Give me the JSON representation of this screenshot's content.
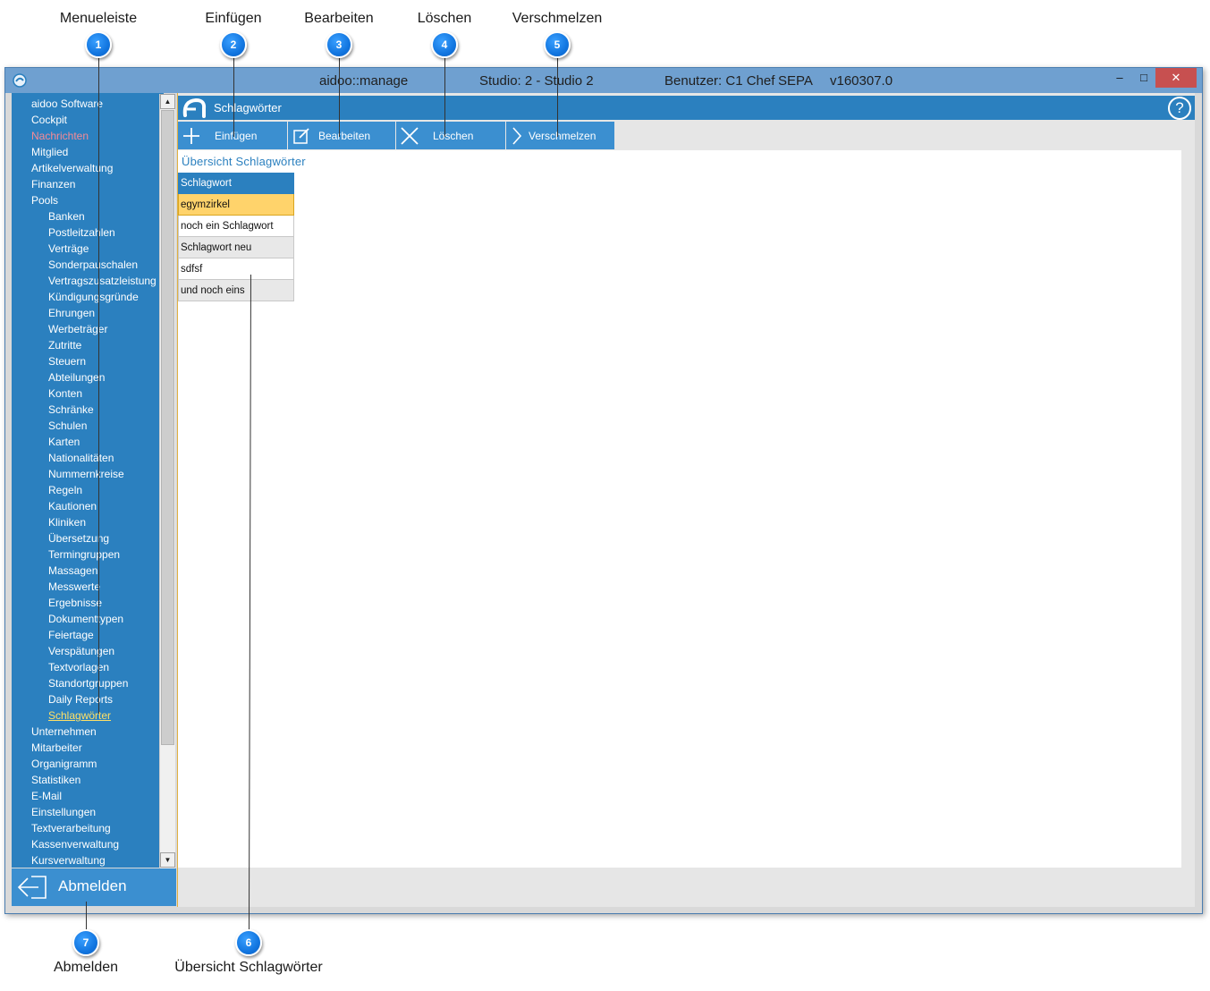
{
  "callouts": [
    {
      "num": "1",
      "label": "Menueleiste"
    },
    {
      "num": "2",
      "label": "Einfügen"
    },
    {
      "num": "3",
      "label": "Bearbeiten"
    },
    {
      "num": "4",
      "label": "Löschen"
    },
    {
      "num": "5",
      "label": "Verschmelzen"
    },
    {
      "num": "6",
      "label": "Übersicht Schlagwörter"
    },
    {
      "num": "7",
      "label": "Abmelden"
    }
  ],
  "window": {
    "app_name": "aidoo::manage",
    "studio": "Studio: 2 - Studio 2",
    "user": "Benutzer: C1 Chef",
    "mode": "SEPA",
    "version": "v160307.0",
    "minimize": "–",
    "maximize": "□",
    "close": "✕"
  },
  "sidebar": {
    "items": [
      {
        "label": "aidoo Software"
      },
      {
        "label": "Cockpit"
      },
      {
        "label": "Nachrichten"
      },
      {
        "label": "Mitglied"
      },
      {
        "label": "Artikelverwaltung"
      },
      {
        "label": "Finanzen"
      },
      {
        "label": "Pools"
      },
      {
        "label": "Banken"
      },
      {
        "label": "Postleitzahlen"
      },
      {
        "label": "Verträge"
      },
      {
        "label": "Sonderpauschalen"
      },
      {
        "label": "Vertragszusatzleistung"
      },
      {
        "label": "Kündigungsgründe"
      },
      {
        "label": "Ehrungen"
      },
      {
        "label": "Werbeträger"
      },
      {
        "label": "Zutritte"
      },
      {
        "label": "Steuern"
      },
      {
        "label": "Abteilungen"
      },
      {
        "label": "Konten"
      },
      {
        "label": "Schränke"
      },
      {
        "label": "Schulen"
      },
      {
        "label": "Karten"
      },
      {
        "label": "Nationalitäten"
      },
      {
        "label": "Nummernkreise"
      },
      {
        "label": "Regeln"
      },
      {
        "label": "Kautionen"
      },
      {
        "label": "Kliniken"
      },
      {
        "label": "Übersetzung"
      },
      {
        "label": "Termingruppen"
      },
      {
        "label": "Massagen"
      },
      {
        "label": "Messwerte"
      },
      {
        "label": "Ergebnisse"
      },
      {
        "label": "Dokumenttypen"
      },
      {
        "label": "Feiertage"
      },
      {
        "label": "Verspätungen"
      },
      {
        "label": "Textvorlagen"
      },
      {
        "label": "Standortgruppen"
      },
      {
        "label": "Daily Reports"
      },
      {
        "label": "Schlagwörter"
      },
      {
        "label": "Unternehmen"
      },
      {
        "label": "Mitarbeiter"
      },
      {
        "label": "Organigramm"
      },
      {
        "label": "Statistiken"
      },
      {
        "label": "E-Mail"
      },
      {
        "label": "Einstellungen"
      },
      {
        "label": "Textverarbeitung"
      },
      {
        "label": "Kassenverwaltung"
      },
      {
        "label": "Kursverwaltung"
      }
    ],
    "scroll_up": "▲",
    "scroll_down": "▼",
    "logout_label": "Abmelden"
  },
  "main": {
    "title": "Schlagwörter",
    "help": "?",
    "toolbar": {
      "insert": "Einfügen",
      "edit": "Bearbeiten",
      "delete": "Löschen",
      "merge": "Verschmelzen"
    },
    "section_title": "Übersicht Schlagwörter",
    "table": {
      "header": "Schlagwort",
      "rows": [
        "egymzirkel",
        "noch ein Schlagwort",
        "Schlagwort neu",
        "sdfsf",
        "und noch eins"
      ]
    }
  },
  "colors": {
    "accent": "#2b80bf",
    "button": "#3b8fd0",
    "selected_row": "#ffd36b",
    "alert_text": "#f58a96",
    "active_text": "#ffe066",
    "callout": "#1276e0"
  }
}
